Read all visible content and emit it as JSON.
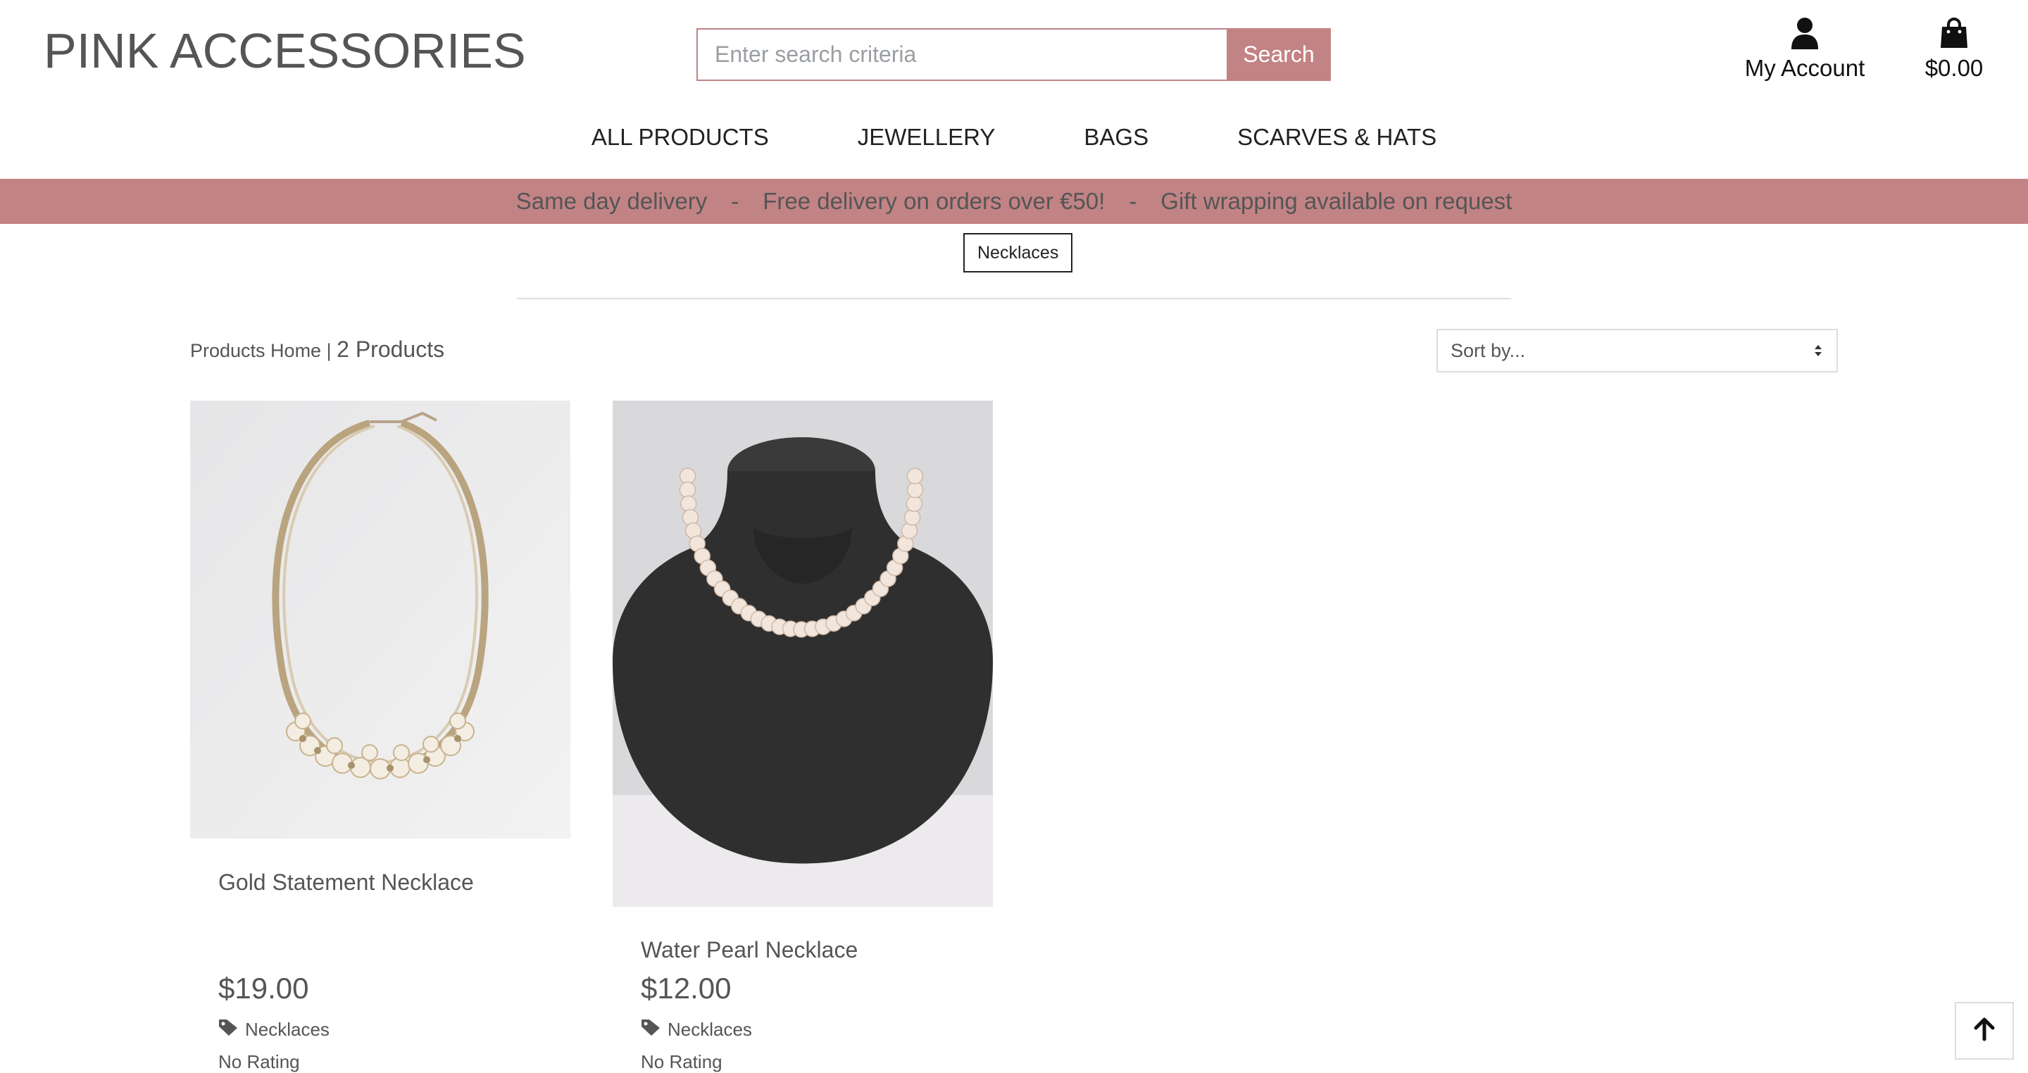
{
  "header": {
    "logo": "PINK ACCESSORIES",
    "search": {
      "placeholder": "Enter search criteria",
      "button_label": "Search"
    },
    "account_label": "My Account",
    "cart_total": "$0.00"
  },
  "nav": {
    "items": [
      {
        "label": "ALL PRODUCTS"
      },
      {
        "label": "JEWELLERY"
      },
      {
        "label": "BAGS"
      },
      {
        "label": "SCARVES & HATS"
      }
    ]
  },
  "banner": {
    "messages": [
      "Same day delivery",
      "Free delivery on orders over €50!",
      "Gift wrapping available on request"
    ],
    "separator": "-"
  },
  "category_filter": {
    "label": "Necklaces"
  },
  "toolbar": {
    "breadcrumb_link": "Products Home",
    "breadcrumb_sep": "|",
    "product_count": "2 Products",
    "sort_label": "Sort by..."
  },
  "products": [
    {
      "name": "Gold Statement Necklace",
      "price": "$19.00",
      "category": "Necklaces",
      "rating": "No Rating"
    },
    {
      "name": "Water Pearl Necklace",
      "price": "$12.00",
      "category": "Necklaces",
      "rating": "No Rating"
    }
  ],
  "icons": {
    "account": "user-icon",
    "cart": "shopping-bag-icon",
    "tag": "tag-icon",
    "back_to_top": "arrow-up-icon"
  },
  "colors": {
    "accent": "#c28385",
    "text": "#555555",
    "background": "#ffffff"
  }
}
